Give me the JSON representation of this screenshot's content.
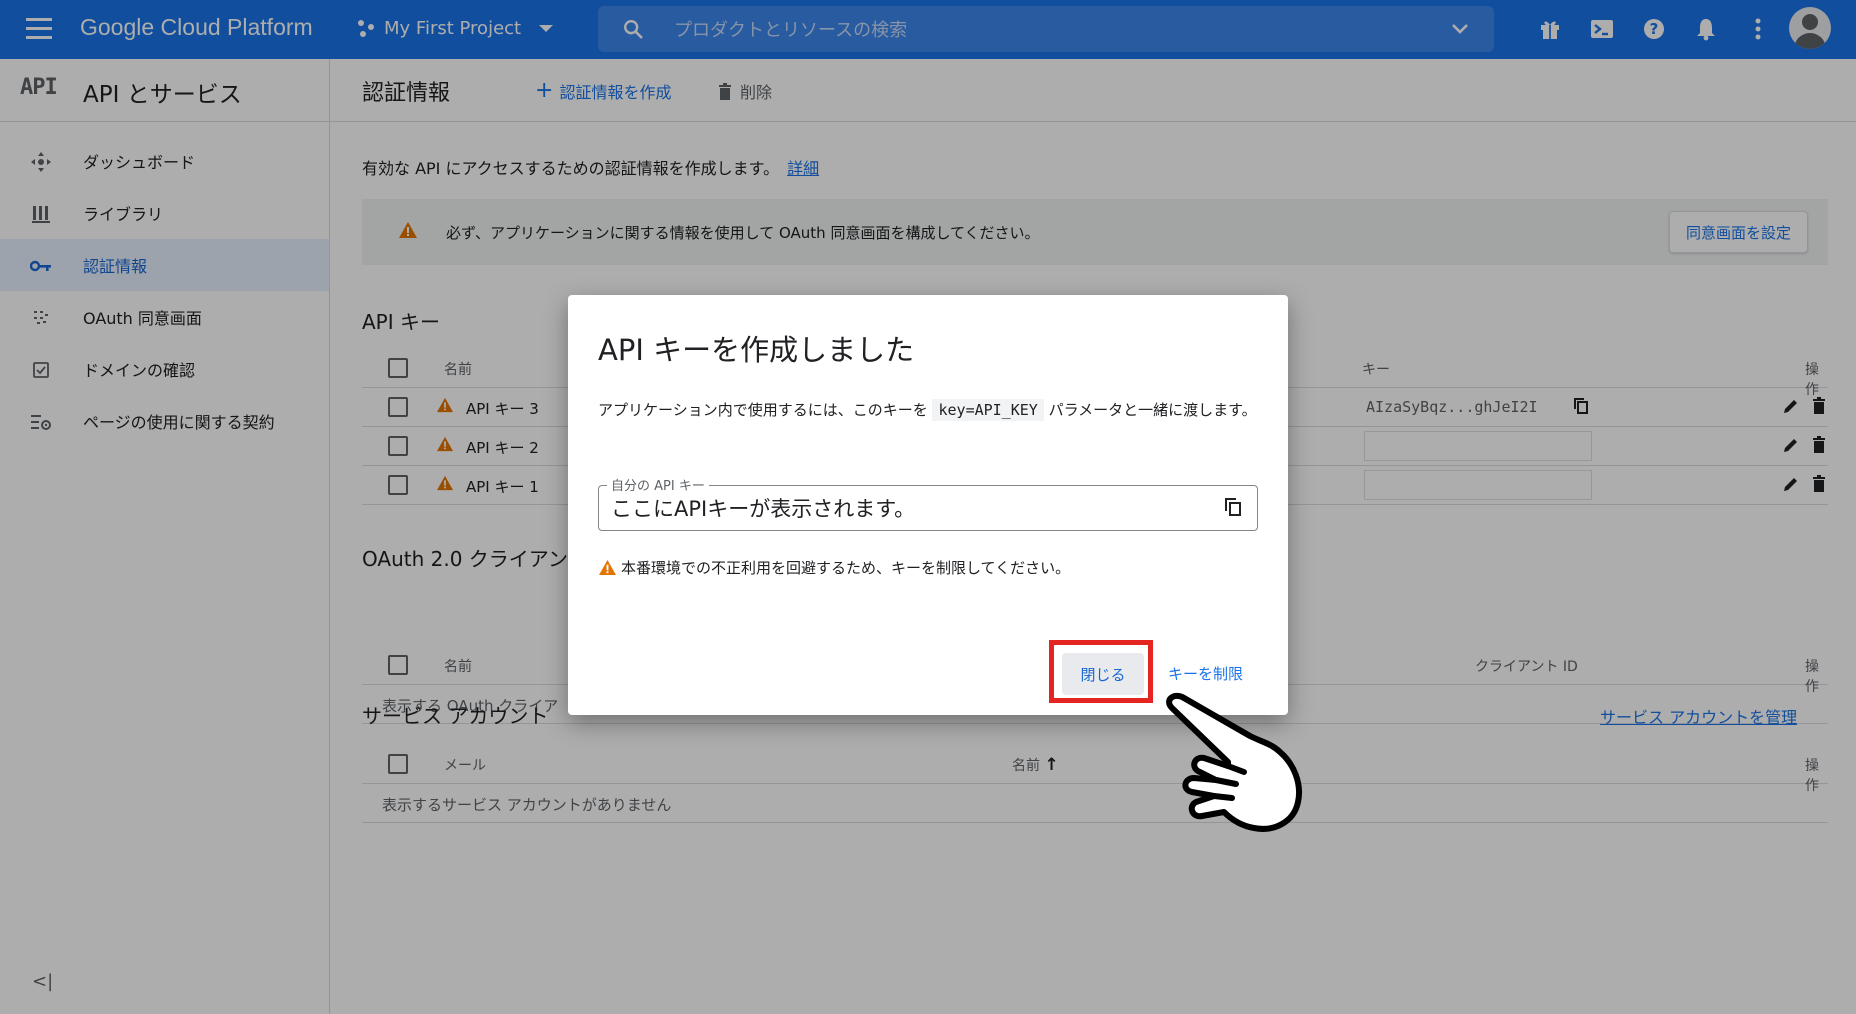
{
  "topbar": {
    "logo": "Google Cloud Platform",
    "project": "My First Project",
    "search_placeholder": "プロダクトとリソースの検索",
    "icons": [
      "gift-icon",
      "terminal-icon",
      "help-icon",
      "bell-icon",
      "more-vert-icon"
    ]
  },
  "sidebar": {
    "logo_text": "API",
    "title": "API とサービス",
    "items": [
      {
        "label": "ダッシュボード",
        "icon": "dashboard-icon"
      },
      {
        "label": "ライブラリ",
        "icon": "library-icon"
      },
      {
        "label": "認証情報",
        "icon": "key-icon",
        "active": true
      },
      {
        "label": "OAuth 同意画面",
        "icon": "oauth-icon"
      },
      {
        "label": "ドメインの確認",
        "icon": "domain-check-icon"
      },
      {
        "label": "ページの使用に関する契約",
        "icon": "settings-list-icon"
      }
    ],
    "collapse": "<|"
  },
  "main": {
    "title": "認証情報",
    "create_label": "認証情報を作成",
    "delete_label": "削除",
    "intro": "有効な API にアクセスするための認証情報を作成します。",
    "intro_link": "詳細",
    "banner_text": "必ず、アプリケーションに関する情報を使用して OAuth 同意画面を構成してください。",
    "banner_button": "同意画面を設定",
    "api_keys": {
      "title": "API キー",
      "columns": {
        "name": "名前",
        "key": "キー",
        "actions": "操作"
      },
      "rows": [
        {
          "name": "API キー 3",
          "key": "AIzaSyBqz...ghJeI2I"
        },
        {
          "name": "API キー 2",
          "key": ""
        },
        {
          "name": "API キー 1",
          "key": ""
        }
      ]
    },
    "oauth": {
      "title": "OAuth 2.0 クライアン",
      "columns": {
        "name": "名前",
        "client_id": "クライアント ID",
        "actions": "操作"
      },
      "empty": "表示する OAuth クライア"
    },
    "service": {
      "title": "サービス アカウント",
      "manage_link": "サービス アカウントを管理",
      "columns": {
        "email": "メール",
        "name": "名前",
        "sort_arrow": "↑",
        "actions": "操作"
      },
      "empty": "表示するサービス アカウントがありません"
    }
  },
  "dialog": {
    "title": "API キーを作成しました",
    "text_before": "アプリケーション内で使用するには、このキーを",
    "code": "key=API_KEY",
    "text_after": "パラメータと一緒に渡します。",
    "field_label": "自分の API キー",
    "field_value": "ここにAPIキーが表示されます。",
    "warning": "本番環境での不正利用を回避するため、キーを制限してください。",
    "close_button": "閉じる",
    "restrict_button": "キーを制限"
  },
  "colors": {
    "brand": "#1a73e8",
    "warning": "#e37400",
    "highlight": "#e52521"
  }
}
